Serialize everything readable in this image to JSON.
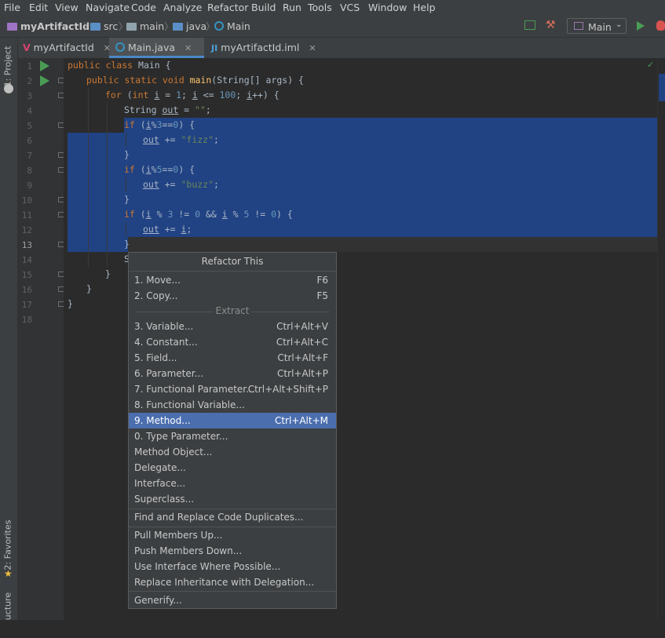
{
  "menu": [
    "File",
    "Edit",
    "View",
    "Navigate",
    "Code",
    "Analyze",
    "Refactor",
    "Build",
    "Run",
    "Tools",
    "VCS",
    "Window",
    "Help"
  ],
  "breadcrumb": {
    "project": "myArtifactId",
    "src": "src",
    "main": "main",
    "java": "java",
    "file": "Main"
  },
  "toolbar": {
    "run_config": "Main"
  },
  "side_tools": {
    "project": "1: Project",
    "favorites": "2: Favorites",
    "structure": "ucture"
  },
  "tabs": [
    {
      "label": "myArtifactId",
      "active": false
    },
    {
      "label": "Main.java",
      "active": true
    },
    {
      "label": "myArtifactId.iml",
      "active": false
    }
  ],
  "line_numbers": [
    "1",
    "2",
    "3",
    "4",
    "5",
    "6",
    "7",
    "8",
    "9",
    "10",
    "11",
    "12",
    "13",
    "14",
    "15",
    "16",
    "17",
    "18"
  ],
  "code": {
    "l1": [
      "public class ",
      "Main {"
    ],
    "l2": [
      "public static void ",
      "main",
      "(String[] args) {"
    ],
    "l3": [
      "for ",
      "(",
      "int ",
      "i",
      " = ",
      "1",
      "; ",
      "i",
      " <= ",
      "100",
      "; ",
      "i",
      "++) {"
    ],
    "l4": [
      "String ",
      "out",
      " = ",
      "\"\"",
      ";"
    ],
    "l5": [
      "if ",
      "(",
      "i",
      "%",
      "3",
      "==",
      "0",
      ") {"
    ],
    "l6": [
      "out",
      " += ",
      "\"fizz\"",
      ";"
    ],
    "l7": [
      "}"
    ],
    "l8": [
      "if ",
      "(",
      "i",
      "%",
      "5",
      "==",
      "0",
      ") {"
    ],
    "l9": [
      "out",
      " += ",
      "\"buzz\"",
      ";"
    ],
    "l10": [
      "}"
    ],
    "l11": [
      "if ",
      "(",
      "i",
      " % ",
      "3",
      " != ",
      "0",
      " && ",
      "i",
      " % ",
      "5",
      " != ",
      "0",
      ") {"
    ],
    "l12": [
      "out",
      " += ",
      "i",
      ";"
    ],
    "l13": [
      "}"
    ],
    "l14": [
      "S"
    ],
    "l15": [
      "}"
    ],
    "l16": [
      "}"
    ],
    "l17": [
      "}"
    ]
  },
  "popup": {
    "title": "Refactor This",
    "items_a": [
      {
        "label": "1. Move...",
        "key": "F6"
      },
      {
        "label": "2. Copy...",
        "key": "F5"
      }
    ],
    "extract_header": "Extract",
    "items_b": [
      {
        "label": "3. Variable...",
        "key": "Ctrl+Alt+V"
      },
      {
        "label": "4. Constant...",
        "key": "Ctrl+Alt+C"
      },
      {
        "label": "5. Field...",
        "key": "Ctrl+Alt+F"
      },
      {
        "label": "6. Parameter...",
        "key": "Ctrl+Alt+P"
      },
      {
        "label": "7. Functional Parameter...",
        "key": "Ctrl+Alt+Shift+P"
      },
      {
        "label": "8. Functional Variable...",
        "key": ""
      },
      {
        "label": "9. Method...",
        "key": "Ctrl+Alt+M",
        "highlight": true
      },
      {
        "label": "0. Type Parameter...",
        "key": ""
      },
      {
        "label": "Method Object...",
        "key": ""
      },
      {
        "label": "Delegate...",
        "key": ""
      },
      {
        "label": "Interface...",
        "key": ""
      },
      {
        "label": "Superclass...",
        "key": ""
      }
    ],
    "items_c": [
      {
        "label": "Find and Replace Code Duplicates...",
        "key": ""
      }
    ],
    "items_d": [
      {
        "label": "Pull Members Up...",
        "key": ""
      },
      {
        "label": "Push Members Down...",
        "key": ""
      },
      {
        "label": "Use Interface Where Possible...",
        "key": ""
      },
      {
        "label": "Replace Inheritance with Delegation...",
        "key": ""
      }
    ],
    "items_e": [
      {
        "label": "Generify...",
        "key": ""
      }
    ]
  },
  "colors": {
    "selection": "#214283",
    "menu_highlight": "#4b6eaf",
    "keyword": "#cc7832",
    "method": "#ffc66d",
    "string": "#6a8759",
    "number": "#6897bb",
    "run_green": "#499c54"
  }
}
